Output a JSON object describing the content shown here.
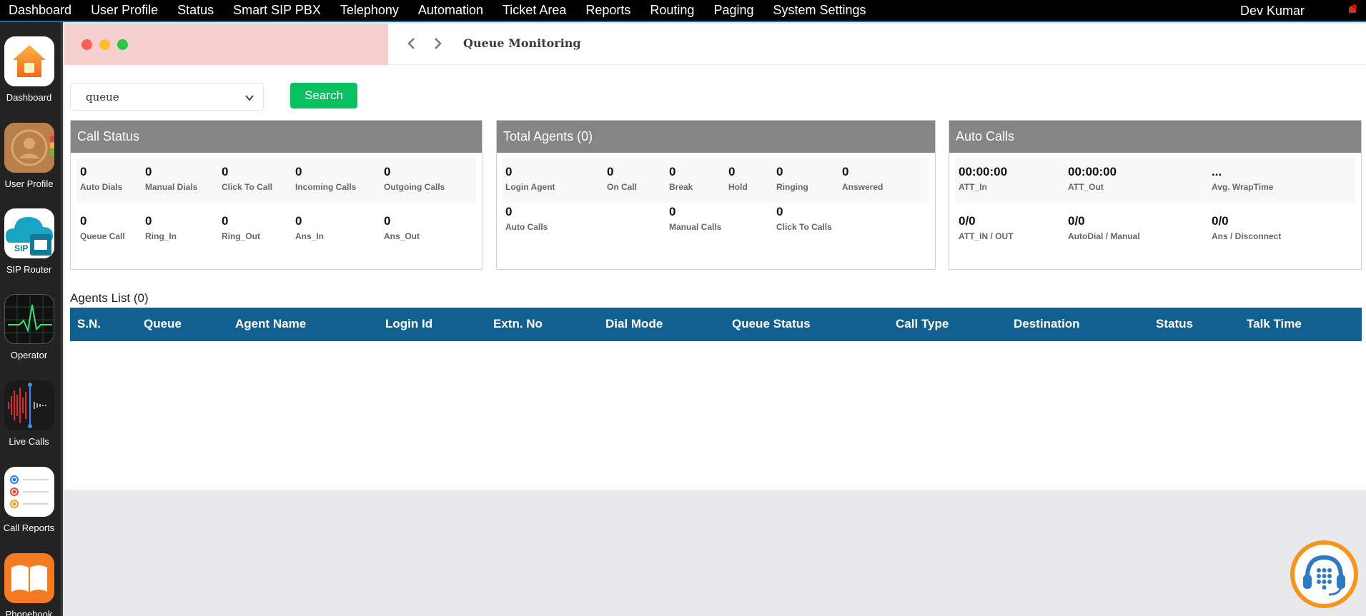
{
  "menubar": {
    "items": [
      "Dashboard",
      "User Profile",
      "Status",
      "Smart SIP PBX",
      "Telephony",
      "Automation",
      "Ticket Area",
      "Reports",
      "Routing",
      "Paging",
      "System Settings"
    ],
    "user": "Dev Kumar"
  },
  "dock": {
    "items": [
      {
        "label": "Dashboard",
        "icon": "home-icon"
      },
      {
        "label": "User Profile",
        "icon": "contacts-icon"
      },
      {
        "label": "SIP Router",
        "icon": "sip-router-icon"
      },
      {
        "label": "Operator",
        "icon": "activity-monitor-icon"
      },
      {
        "label": "Live Calls",
        "icon": "waveform-icon"
      },
      {
        "label": "Call Reports",
        "icon": "reminders-icon"
      },
      {
        "label": "Phonebook",
        "icon": "book-icon"
      }
    ]
  },
  "window": {
    "title": "Queue Monitoring",
    "select_value": "queue",
    "search_label": "Search"
  },
  "call_status": {
    "title": "Call Status",
    "row1": [
      {
        "value": "0",
        "label": "Auto Dials"
      },
      {
        "value": "0",
        "label": "Manual Dials"
      },
      {
        "value": "0",
        "label": "Click To Call"
      },
      {
        "value": "0",
        "label": "Incoming Calls"
      },
      {
        "value": "0",
        "label": "Outgoing Calls"
      }
    ],
    "row2": [
      {
        "value": "0",
        "label": "Queue Call"
      },
      {
        "value": "0",
        "label": "Ring_In"
      },
      {
        "value": "0",
        "label": "Ring_Out"
      },
      {
        "value": "0",
        "label": "Ans_In"
      },
      {
        "value": "0",
        "label": "Ans_Out"
      }
    ]
  },
  "total_agents": {
    "title": "Total Agents (0)",
    "row1": [
      {
        "value": "0",
        "label": "Login Agent"
      },
      {
        "value": "0",
        "label": "On Call"
      },
      {
        "value": "0",
        "label": "Break"
      },
      {
        "value": "0",
        "label": "Hold"
      },
      {
        "value": "0",
        "label": "Ringing"
      },
      {
        "value": "0",
        "label": "Answered"
      }
    ],
    "row2": [
      {
        "value": "0",
        "label": "Auto Calls"
      },
      {
        "value": "0",
        "label": "Manual Calls"
      },
      {
        "value": "0",
        "label": "Click To Calls"
      }
    ]
  },
  "auto_calls": {
    "title": "Auto Calls",
    "row1": [
      {
        "value": "00:00:00",
        "label": "ATT_In"
      },
      {
        "value": "00:00:00",
        "label": "ATT_Out"
      },
      {
        "value": "...",
        "label": "Avg. WrapTime"
      }
    ],
    "row2": [
      {
        "value": "0/0",
        "label": "ATT_IN / OUT"
      },
      {
        "value": "0/0",
        "label": "AutoDial / Manual"
      },
      {
        "value": "0/0",
        "label": "Ans / Disconnect"
      }
    ]
  },
  "agents_list": {
    "title": "Agents List (0)",
    "columns": [
      "S.N.",
      "Queue",
      "Agent Name",
      "Login Id",
      "Extn. No",
      "Dial Mode",
      "Queue Status",
      "Call Type",
      "Destination",
      "Status",
      "Talk Time"
    ]
  },
  "colors": {
    "accent_green": "#07c160",
    "table_header": "#11608f",
    "panel_header": "#858585",
    "fab_ring": "#f7941d"
  }
}
